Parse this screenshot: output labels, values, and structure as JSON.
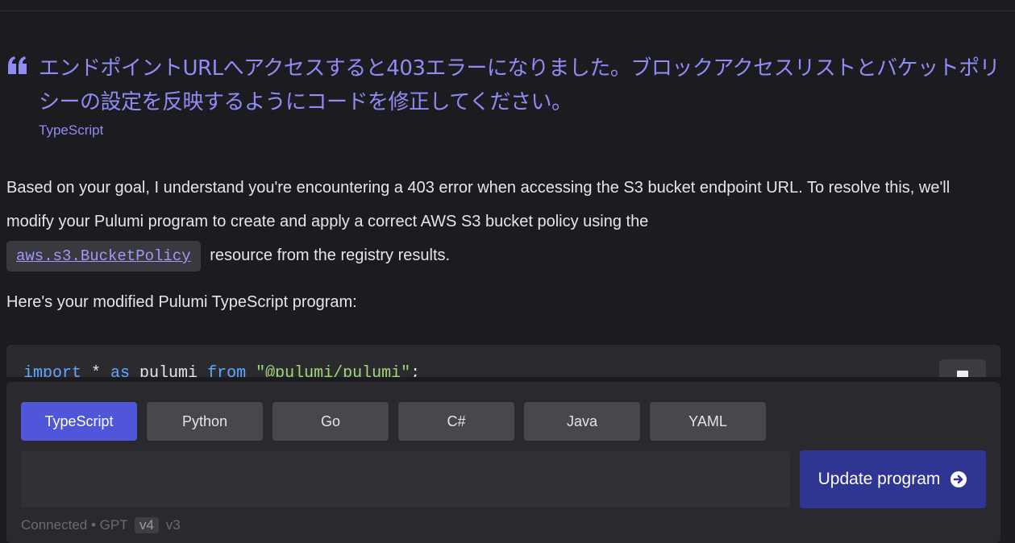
{
  "prompt": {
    "text": "エンドポイントURLへアクセスすると403エラーになりました。ブロックアクセスリストとバケットポリシーの設定を反映するようにコードを修正してください。",
    "language": "TypeScript"
  },
  "answer": {
    "paragraph_start": "Based on your goal, I understand you're encountering a 403 error when accessing the S3 bucket endpoint URL. To resolve this, we'll modify your Pulumi program to create and apply a correct AWS S3 bucket policy using the",
    "code_ref": "aws.s3.BucketPolicy",
    "paragraph_end": "resource from the registry results.",
    "intro": "Here's your modified Pulumi TypeScript program:"
  },
  "code": {
    "kw_import": "import",
    "star": " * ",
    "kw_as": "as",
    "ident": " pulumi ",
    "kw_from": "from",
    "sp": " ",
    "module": "\"@pulumi/pulumi\"",
    "semi": ";"
  },
  "languages": [
    "TypeScript",
    "Python",
    "Go",
    "C#",
    "Java",
    "YAML"
  ],
  "selected_language": "TypeScript",
  "input": {
    "value": "",
    "placeholder": ""
  },
  "update_button": {
    "label": "Update program"
  },
  "status": {
    "connected": "Connected",
    "sep": "•",
    "model": "GPT",
    "version_selected": "v4",
    "version_other": "v3"
  },
  "colors": {
    "accent": "#4f56d9",
    "quote": "#8f8cf5",
    "update_button": "#2f3593",
    "background": "#1c1b1f"
  },
  "icons": {
    "quote": "quote-icon",
    "copy": "copy-icon",
    "submit": "arrow-circle-right-icon"
  }
}
